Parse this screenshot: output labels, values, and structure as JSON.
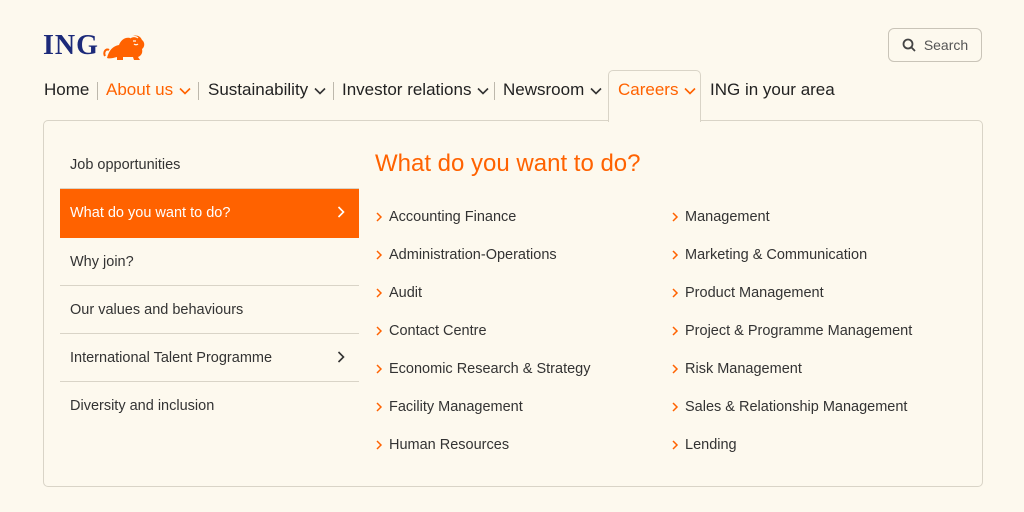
{
  "brand": {
    "name": "ING",
    "logo_icon": "lion-icon",
    "accent": "#ff6200",
    "navy": "#1c2a7a"
  },
  "search": {
    "label": "Search",
    "icon": "search-icon"
  },
  "nav": {
    "items": [
      {
        "label": "Home",
        "has_chevron": false,
        "active": false
      },
      {
        "label": "About us",
        "has_chevron": true,
        "active": true
      },
      {
        "label": "Sustainability",
        "has_chevron": true,
        "active": false
      },
      {
        "label": "Investor relations",
        "has_chevron": true,
        "active": false
      },
      {
        "label": "Newsroom",
        "has_chevron": true,
        "active": false
      },
      {
        "label": "Careers",
        "has_chevron": true,
        "active": true,
        "open": true
      },
      {
        "label": "ING in your area",
        "has_chevron": false,
        "active": false
      }
    ]
  },
  "sidebar": {
    "items": [
      {
        "label": "Job opportunities",
        "has_arrow": false,
        "selected": false
      },
      {
        "label": "What do you want to do?",
        "has_arrow": true,
        "selected": true
      },
      {
        "label": "Why join?",
        "has_arrow": false,
        "selected": false
      },
      {
        "label": "Our values and behaviours",
        "has_arrow": false,
        "selected": false
      },
      {
        "label": "International Talent Programme",
        "has_arrow": true,
        "selected": false
      },
      {
        "label": "Diversity and inclusion",
        "has_arrow": false,
        "selected": false
      }
    ]
  },
  "main": {
    "heading": "What do you want to do?",
    "left_links": [
      "Accounting Finance",
      "Administration-Operations",
      "Audit",
      "Contact Centre",
      "Economic Research & Strategy",
      "Facility Management",
      "Human Resources"
    ],
    "right_links": [
      "Management",
      "Marketing & Communication",
      "Product Management",
      "Project & Programme Management",
      "Risk Management",
      "Sales & Relationship Management",
      "Lending"
    ]
  }
}
